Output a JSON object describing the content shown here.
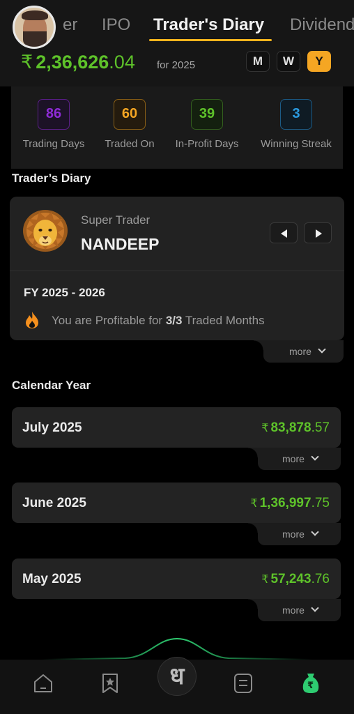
{
  "tabs": [
    "er",
    "IPO",
    "Trader's Diary",
    "Dividend"
  ],
  "header": {
    "amount_currency": "₹",
    "amount_whole": "2,36,626",
    "amount_decimal": ".04",
    "for_year": "for 2025",
    "period_buttons": [
      "M",
      "W",
      "Y"
    ],
    "active_period": "Y"
  },
  "stats": [
    {
      "value": "86",
      "label": "Trading Days",
      "color": "#8e2bd6"
    },
    {
      "value": "60",
      "label": "Traded On",
      "color": "#f5a623"
    },
    {
      "value": "39",
      "label": "In-Profit Days",
      "color": "#5ec22a"
    },
    {
      "value": "3",
      "label": "Winning Streak",
      "color": "#2b9be0"
    }
  ],
  "diary": {
    "section_title": "Trader’s Diary",
    "rank_label": "Super Trader",
    "trader_name": "NANDEEP",
    "fy": "FY 2025 - 2026",
    "profit_prefix": "You are Profitable for ",
    "profit_count": "3/3",
    "profit_suffix": " Traded Months",
    "more": "more"
  },
  "calendar": {
    "section_title": "Calendar Year",
    "more": "more",
    "months": [
      {
        "name": "July 2025",
        "currency": "₹",
        "whole": "83,878",
        "decimal": ".57"
      },
      {
        "name": "June 2025",
        "currency": "₹",
        "whole": "1,36,997",
        "decimal": ".75"
      },
      {
        "name": "May 2025",
        "currency": "₹",
        "whole": "57,243",
        "decimal": ".76"
      }
    ]
  },
  "bottom_nav": {
    "center_glyph": "ध",
    "wallet_glyph": "₹",
    "icons": [
      "home-icon",
      "bookmark-star-icon",
      "logo-icon",
      "list-icon",
      "money-bag-icon"
    ],
    "accent_color": "#2ecc71"
  }
}
